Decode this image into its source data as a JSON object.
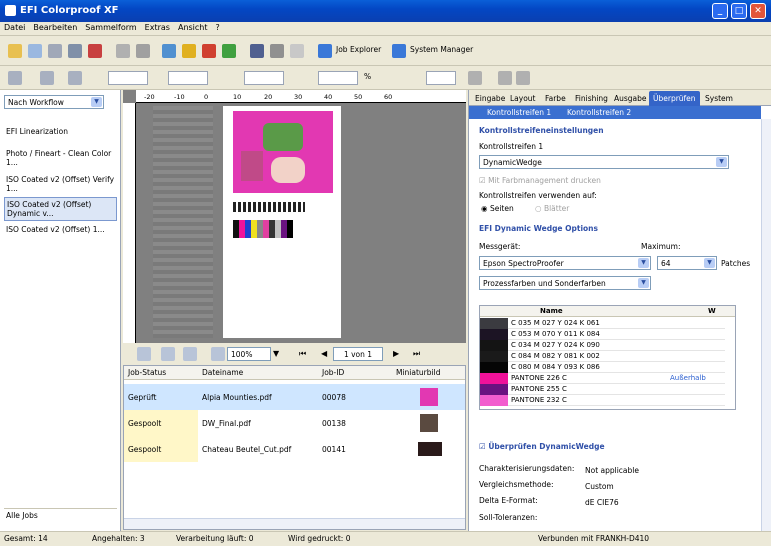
{
  "title": "EFI Colorproof XF",
  "window_buttons": {
    "min": "_",
    "max": "□",
    "close": "✕"
  },
  "menu": [
    "Datei",
    "Bearbeiten",
    "Sammelform",
    "Extras",
    "Ansicht",
    "?"
  ],
  "toolbar": {
    "job_explorer": "Job Explorer",
    "system_manager": "System Manager"
  },
  "zoom_field": "%",
  "workflow_select": "Nach Workflow",
  "workflows": [
    "EFI Linearization",
    "Photo / Fineart - Clean Color 1...",
    "ISO Coated v2 (Offset) Verify 1...",
    "ISO Coated v2 (Offset) Dynamic v...",
    "ISO Coated v2 (Offset) 1..."
  ],
  "all_jobs": "Alle Jobs",
  "ruler_ticks": [
    "-20",
    "-10",
    "0",
    "10",
    "20",
    "30",
    "40",
    "50",
    "60"
  ],
  "nav": {
    "zoom": "100%",
    "page": "1 von 1"
  },
  "table": {
    "headers": [
      "Job-Status",
      "Dateiname",
      "Job-ID",
      "Miniaturbild"
    ],
    "rows": [
      {
        "status": "Geprüft",
        "file": "Alpia Mounties.pdf",
        "id": "00078",
        "color": "#bfe4ff"
      },
      {
        "status": "Gespoolt",
        "file": "DW_Final.pdf",
        "id": "00138",
        "color": "#fff7c8"
      },
      {
        "status": "Gespoolt",
        "file": "Chateau Beutel_Cut.pdf",
        "id": "00141",
        "color": "#fff7c8"
      }
    ]
  },
  "status": {
    "total": "Gesamt: 14",
    "held": "Angehalten: 3",
    "processing": "Verarbeitung läuft: 0",
    "printing": "Wird gedruckt: 0",
    "connected": "Verbunden mit FRANKH-D410"
  },
  "right": {
    "tabs": [
      "Eingabe",
      "Layout",
      "Farbe",
      "Finishing",
      "Ausgabe",
      "Überprüfen",
      "System"
    ],
    "subtabs": [
      "Kontrollstreifen 1",
      "Kontrollstreifen 2"
    ],
    "sec1": "Kontrollstreifeneinstellungen",
    "strip_label": "Kontrollstreifen 1",
    "strip_value": "DynamicWedge",
    "color_mgmt": "Mit Farbmanagement drucken",
    "use_on": "Kontrollstreifen verwenden auf:",
    "opt_pages": "Seiten",
    "opt_sheets": "Blätter",
    "sec2": "EFI Dynamic Wedge Options",
    "device_label": "Messgerät:",
    "max_label": "Maximum:",
    "device": "Epson SpectroProofer",
    "max_value": "64",
    "patches": "Patches",
    "colors": "Prozessfarben und Sonderfarben",
    "name_header": "Name",
    "w_header": "W",
    "swatches": [
      {
        "name": "C 035 M 027 Y 024 K 061",
        "color": "#3b3b40",
        "extra": ""
      },
      {
        "name": "C 053 M 070 Y 011 K 084",
        "color": "#1c1424",
        "extra": ""
      },
      {
        "name": "C 034 M 027 Y 024 K 090",
        "color": "#141414",
        "extra": ""
      },
      {
        "name": "C 084 M 082 Y 081 K 002",
        "color": "#1a1a1a",
        "extra": ""
      },
      {
        "name": "C 080 M 084 Y 093 K 086",
        "color": "#050505",
        "extra": ""
      },
      {
        "name": "PANTONE 226 C",
        "color": "#f0129a",
        "extra": "Außerhalb"
      },
      {
        "name": "PANTONE 255 C",
        "color": "#6a1280",
        "extra": ""
      },
      {
        "name": "PANTONE 232 C",
        "color": "#f25cce",
        "extra": ""
      }
    ],
    "verify": "Überprüfen DynamicWedge",
    "char_label": "Charakterisierungsdaten:",
    "char_value": "Not applicable",
    "method_label": "Vergleichsmethode:",
    "method_value": "Custom",
    "delta_label": "Delta E-Format:",
    "delta_value": "dE CIE76",
    "tol_label": "Soll-Toleranzen:"
  }
}
